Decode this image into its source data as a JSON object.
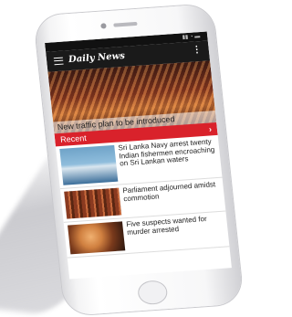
{
  "app": {
    "title": "Daily News",
    "menu_icon": "menu-icon",
    "more_icon": "more-vertical-icon"
  },
  "hero": {
    "caption": "New traffic plan to be introduced"
  },
  "recent": {
    "label": "Recent",
    "chevron": "›"
  },
  "news": [
    {
      "headline": "Sri Lanka Navy arrest twenty Indian fishermen encroaching on Sri Lankan waters"
    },
    {
      "headline": "Parliament adjourned amidst commotion"
    },
    {
      "headline": "Five suspects wanted for murder arrested"
    }
  ],
  "colors": {
    "accent": "#d9222b",
    "app_bar": "#1a1a1a"
  }
}
